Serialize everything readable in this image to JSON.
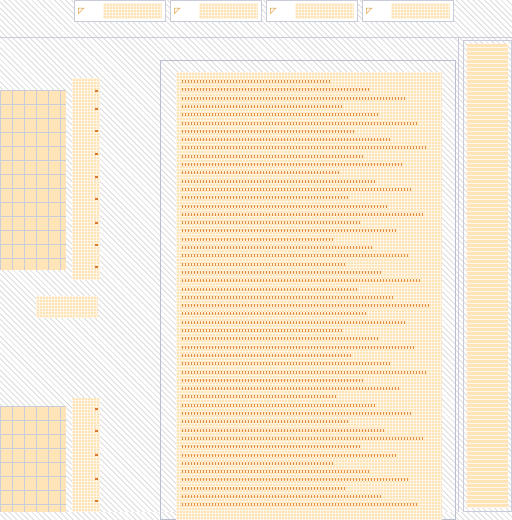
{
  "colors": {
    "background": "#ffffff",
    "hatch": "#dcdcdc",
    "panel_fill": "#ffe4b8",
    "text_marks": "#e07b2c",
    "rule": "#c9ccd8"
  },
  "icons": {
    "thumbnail_glyph": "page-thumbnail-icon"
  }
}
